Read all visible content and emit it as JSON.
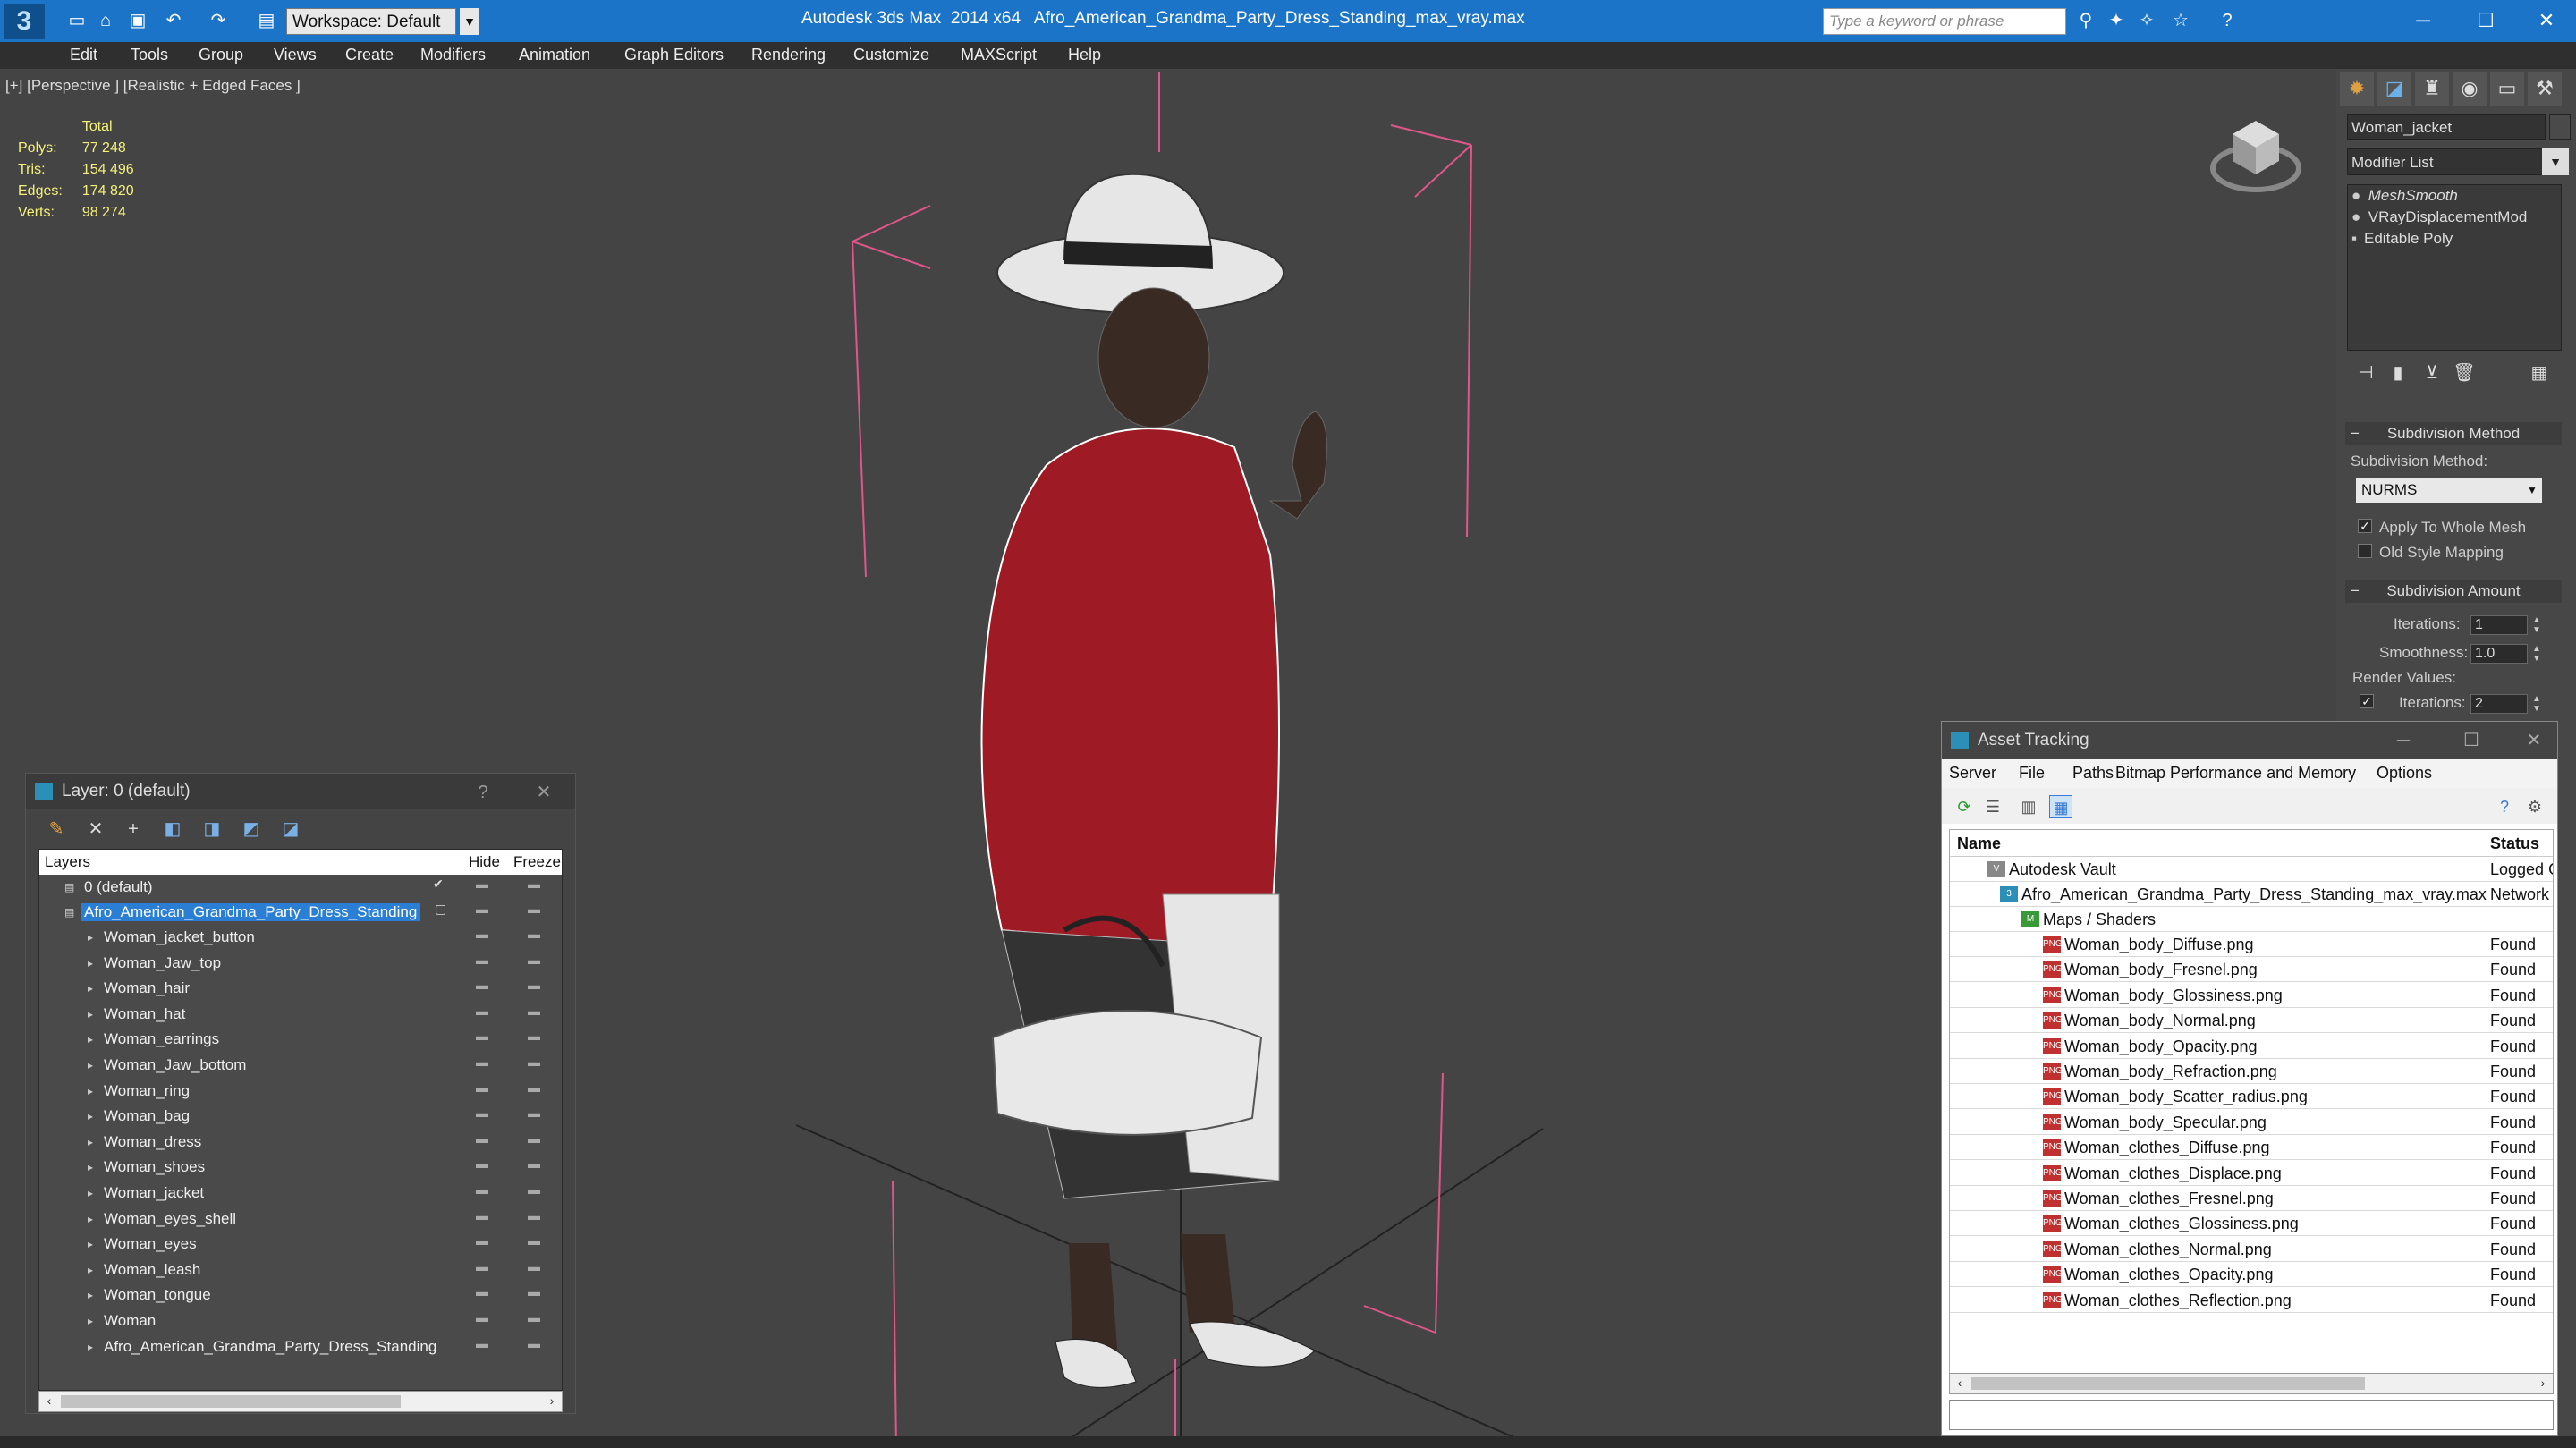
{
  "titlebar": {
    "logo": "3",
    "workspace": "Workspace: Default",
    "app_name": "Autodesk 3ds Max  2014 x64",
    "file_name": "Afro_American_Grandma_Party_Dress_Standing_max_vray.max",
    "search_placeholder": "Type a keyword or phrase",
    "minimize": "─",
    "maximize": "☐",
    "close": "✕"
  },
  "menu": [
    "Edit",
    "Tools",
    "Group",
    "Views",
    "Create",
    "Modifiers",
    "Animation",
    "Graph Editors",
    "Rendering",
    "Customize",
    "MAXScript",
    "Help"
  ],
  "viewport": {
    "label": "[+] [Perspective ] [Realistic + Edged Faces ]",
    "stats_header": "Total",
    "stats": [
      {
        "label": "Polys:",
        "value": "77 248"
      },
      {
        "label": "Tris:",
        "value": "154 496"
      },
      {
        "label": "Edges:",
        "value": "174 820"
      },
      {
        "label": "Verts:",
        "value": "98 274"
      }
    ]
  },
  "command_panel": {
    "object_name": "Woman_jacket",
    "modifier_list": "Modifier List",
    "stack": [
      "MeshSmooth",
      "VRayDisplacementMod",
      "Editable Poly"
    ],
    "subdivision_method_rollout": "Subdivision Method",
    "subdivision_method_label": "Subdivision Method:",
    "subdivision_method_value": "NURMS",
    "apply_whole_mesh": "Apply To Whole Mesh",
    "old_style_mapping": "Old Style Mapping",
    "subdivision_amount_rollout": "Subdivision Amount",
    "iterations_label": "Iterations:",
    "iterations_value": "1",
    "smoothness_label": "Smoothness:",
    "smoothness_value": "1.0",
    "render_values_label": "Render Values:",
    "render_iterations_label": "Iterations:",
    "render_iterations_value": "2"
  },
  "layer_panel": {
    "title": "Layer: 0 (default)",
    "help": "?",
    "close": "✕",
    "col_layers": "Layers",
    "col_hide": "Hide",
    "col_freeze": "Freeze",
    "default_layer": "0 (default)",
    "selected_layer": "Afro_American_Grandma_Party_Dress_Standing",
    "objects": [
      "Woman_jacket_button",
      "Woman_Jaw_top",
      "Woman_hair",
      "Woman_hat",
      "Woman_earrings",
      "Woman_Jaw_bottom",
      "Woman_ring",
      "Woman_bag",
      "Woman_dress",
      "Woman_shoes",
      "Woman_jacket",
      "Woman_eyes_shell",
      "Woman_eyes",
      "Woman_leash",
      "Woman_tongue",
      "Woman",
      "Afro_American_Grandma_Party_Dress_Standing"
    ]
  },
  "asset_tracking": {
    "title": "Asset Tracking",
    "menu": [
      "Server",
      "File",
      "Paths",
      "Bitmap Performance and Memory",
      "Options"
    ],
    "col_name": "Name",
    "col_status": "Status",
    "vault": "Autodesk Vault",
    "vault_status": "Logged O",
    "file": "Afro_American_Grandma_Party_Dress_Standing_max_vray.max",
    "file_status": "Network P",
    "maps_folder": "Maps / Shaders",
    "png_badge": "PNG",
    "maps": [
      {
        "name": "Woman_body_Diffuse.png",
        "status": "Found"
      },
      {
        "name": "Woman_body_Fresnel.png",
        "status": "Found"
      },
      {
        "name": "Woman_body_Glossiness.png",
        "status": "Found"
      },
      {
        "name": "Woman_body_Normal.png",
        "status": "Found"
      },
      {
        "name": "Woman_body_Opacity.png",
        "status": "Found"
      },
      {
        "name": "Woman_body_Refraction.png",
        "status": "Found"
      },
      {
        "name": "Woman_body_Scatter_radius.png",
        "status": "Found"
      },
      {
        "name": "Woman_body_Specular.png",
        "status": "Found"
      },
      {
        "name": "Woman_clothes_Diffuse.png",
        "status": "Found"
      },
      {
        "name": "Woman_clothes_Displace.png",
        "status": "Found"
      },
      {
        "name": "Woman_clothes_Fresnel.png",
        "status": "Found"
      },
      {
        "name": "Woman_clothes_Glossiness.png",
        "status": "Found"
      },
      {
        "name": "Woman_clothes_Normal.png",
        "status": "Found"
      },
      {
        "name": "Woman_clothes_Opacity.png",
        "status": "Found"
      },
      {
        "name": "Woman_clothes_Reflection.png",
        "status": "Found"
      }
    ]
  },
  "colors": {
    "titlebar": "#1c74c9",
    "viewport": "#444444",
    "selection": "#2a7fd4",
    "stats": "#f4f17a",
    "dress": "#9e1a24"
  }
}
